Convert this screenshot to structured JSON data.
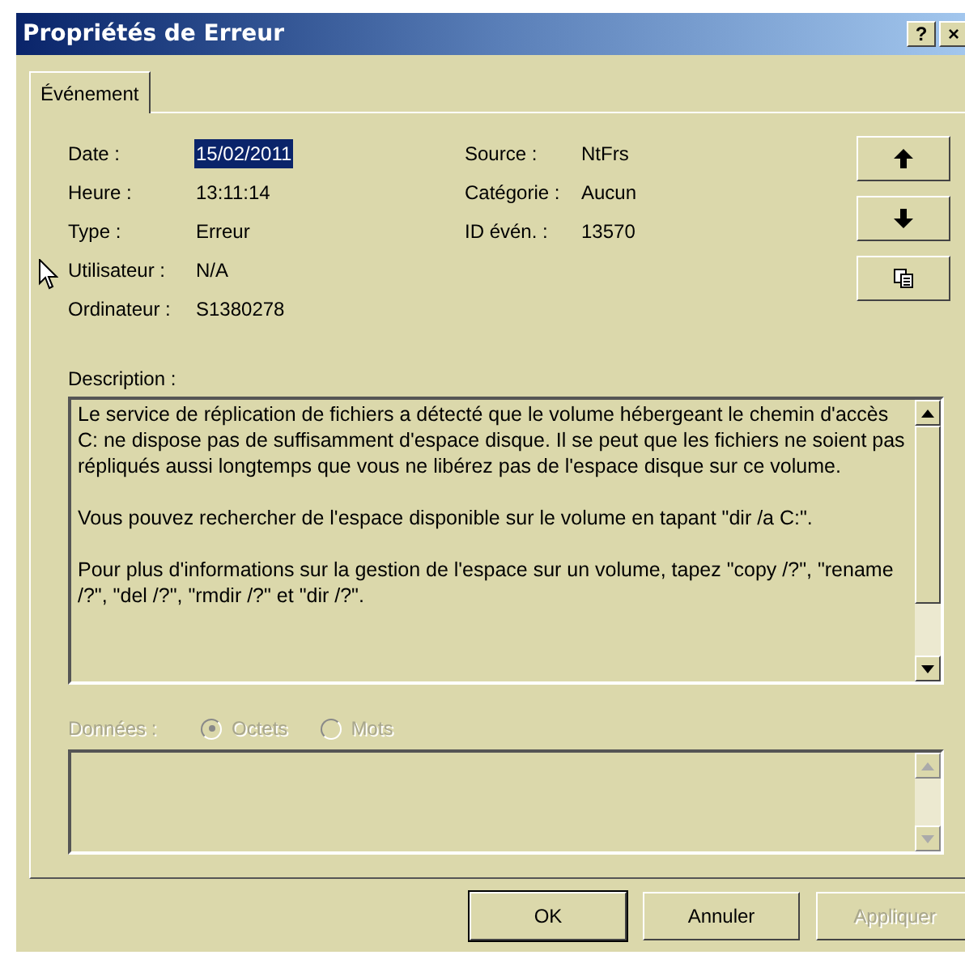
{
  "window": {
    "title": "Propriétés de Erreur",
    "buttons": [
      "?",
      "×"
    ]
  },
  "tabs": [
    {
      "label": "Événement",
      "selected": true
    }
  ],
  "fields_left": [
    {
      "label": "Date :",
      "value": "15/02/2011",
      "selected": true
    },
    {
      "label": "Heure :",
      "value": "13:11:14",
      "selected": false
    },
    {
      "label": "Type :",
      "value": "Erreur",
      "selected": false
    },
    {
      "label": "Utilisateur :",
      "value": "N/A",
      "selected": false
    },
    {
      "label": "Ordinateur :",
      "value": "S1380278",
      "selected": false
    }
  ],
  "fields_right": [
    {
      "label": "Source :",
      "value": "NtFrs"
    },
    {
      "label": "Catégorie :",
      "value": "Aucun"
    },
    {
      "label": "ID évén. :",
      "value": "13570"
    }
  ],
  "side_buttons": [
    {
      "kind": "up"
    },
    {
      "kind": "down"
    },
    {
      "kind": "copy"
    }
  ],
  "description": {
    "label": "Description :",
    "paragraphs": [
      "Le service de réplication de fichiers a détecté que le volume hébergeant le chemin d'accès C: ne dispose pas de suffisamment d'espace disque. Il se peut que les fichiers ne soient pas répliqués aussi longtemps que vous ne libérez pas de l'espace disque sur ce volume.",
      "Vous pouvez rechercher de l'espace disponible sur le volume en tapant \"dir /a C:\".",
      "Pour plus d'informations sur la gestion de l'espace sur un volume, tapez \"copy /?\", \"rename /?\", \"del /?\", \"rmdir /?\" et \"dir /?\"."
    ]
  },
  "data": {
    "label": "Données :",
    "disabled": true,
    "options": [
      {
        "label": "Octets",
        "selected": true
      },
      {
        "label": "Mots",
        "selected": false
      }
    ]
  },
  "buttons": [
    {
      "label": "OK",
      "default": true,
      "disabled": false
    },
    {
      "label": "Annuler",
      "default": false,
      "disabled": false
    },
    {
      "label": "Appliquer",
      "default": false,
      "disabled": true
    }
  ]
}
